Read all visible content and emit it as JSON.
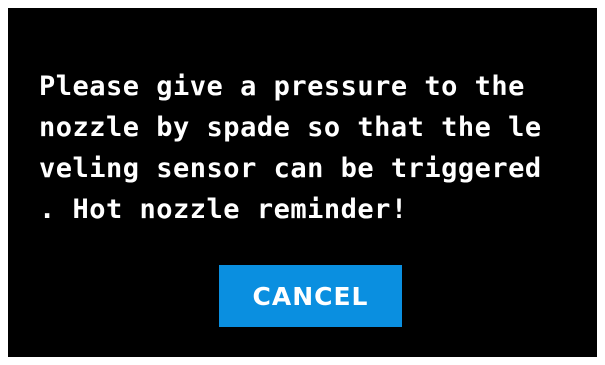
{
  "dialog": {
    "message_lines": [
      "Please give a pressure to the",
      "nozzle by spade so that the le",
      "veling sensor can be triggered",
      ". Hot nozzle reminder!"
    ],
    "cancel_label": "CANCEL"
  },
  "colors": {
    "background": "#000000",
    "text": "#ffffff",
    "button": "#0a8fe0"
  }
}
